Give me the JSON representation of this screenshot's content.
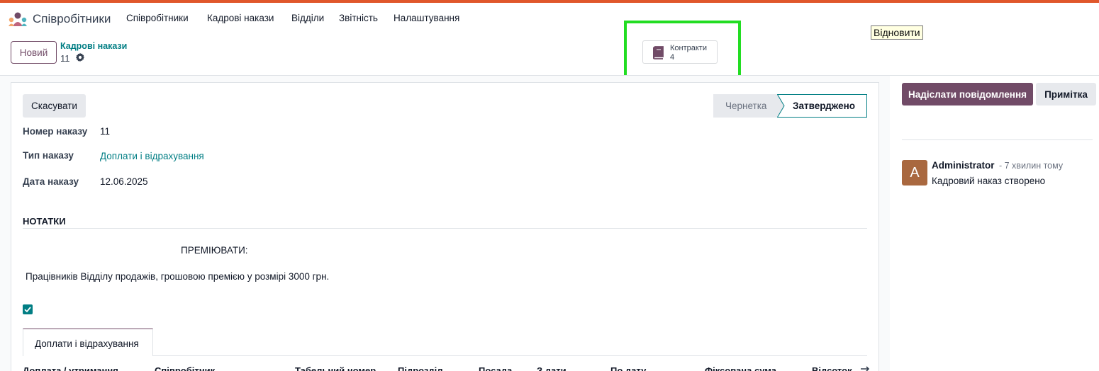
{
  "navbar": {
    "app_name": "Співробітники",
    "menu": [
      "Співробітники",
      "Кадрові накази",
      "Відділи",
      "Звітність",
      "Налаштування"
    ]
  },
  "control_panel": {
    "new_label": "Новий",
    "breadcrumb": "Кадрові накази",
    "record_id": "11",
    "smart_button": {
      "label": "Контракти",
      "count": "4"
    }
  },
  "tooltip": "Відновити",
  "form": {
    "cancel_label": "Скасувати",
    "statuses": [
      "Чернетка",
      "Затверджено"
    ],
    "active_status": "Затверджено",
    "fields": [
      {
        "label": "Номер наказу",
        "value": "11"
      },
      {
        "label": "Тип наказу",
        "value": "Доплати і відрахування"
      },
      {
        "label": "Дата наказу",
        "value": "12.06.2025"
      }
    ],
    "notes_title": "НОТАТКИ",
    "notes_heading": "ПРЕМІЮВАТИ:",
    "notes_body": "Працівників Відділу продажів, грошовою премією у розмірі 3000 грн.",
    "checkbox_checked": true,
    "tab_label": "Доплати і відрахування",
    "columns": [
      "Доплата / утримання",
      "Співробітник",
      "Табельний номер",
      "Підрозділ",
      "Посада",
      "З дати",
      "По дату",
      "Фіксована сума",
      "Відсоток"
    ]
  },
  "chatter": {
    "send_label": "Надіслати повідомлення",
    "note_label": "Примітка",
    "message": {
      "avatar_letter": "A",
      "author": "Administrator",
      "time": "- 7 хвилин тому",
      "body": "Кадровий наказ створено"
    }
  },
  "colors": {
    "brand": "#714b67",
    "link": "#017e84",
    "highlight": "#22dd22",
    "top_bar": "#e0572b"
  }
}
